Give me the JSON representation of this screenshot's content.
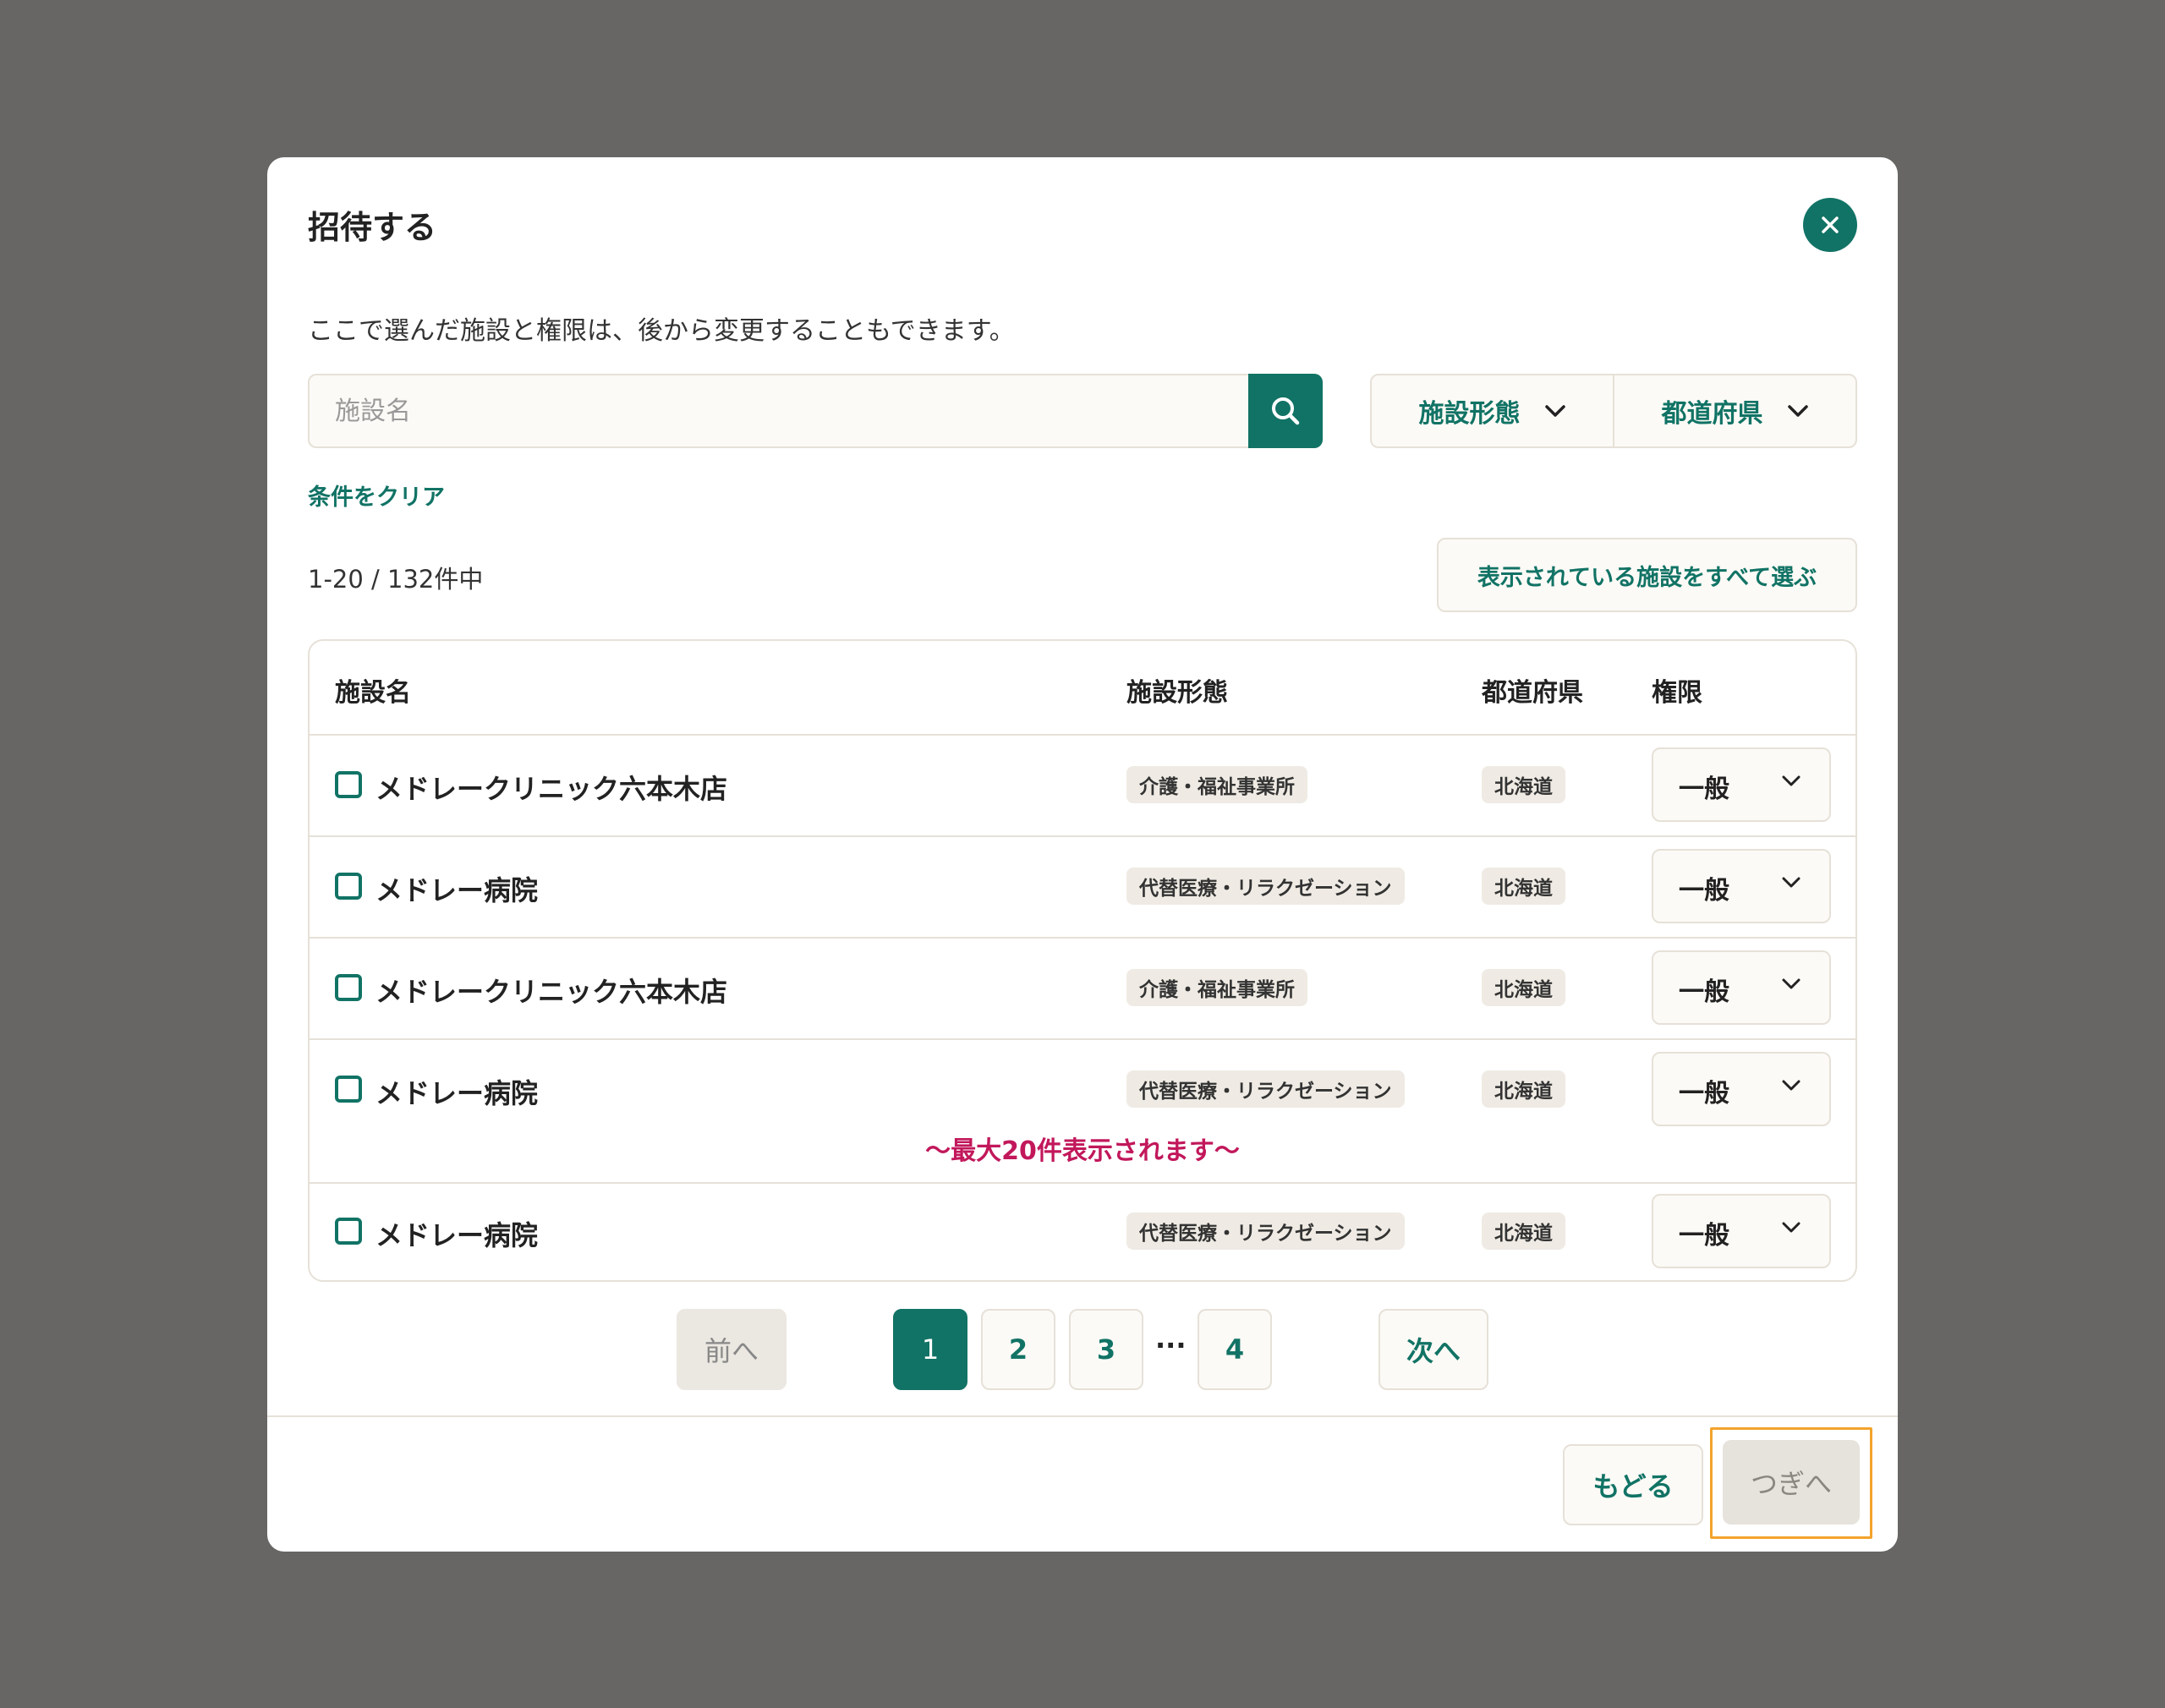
{
  "dialog": {
    "title": "招待する",
    "description": "ここで選んだ施設と権限は、後から変更することもできます。",
    "close_icon": "close-icon"
  },
  "search": {
    "placeholder": "施設名",
    "button_icon": "search-icon"
  },
  "filters": [
    {
      "label": "施設形態",
      "icon": "chevron-down-icon"
    },
    {
      "label": "都道府県",
      "icon": "chevron-down-icon"
    }
  ],
  "clear_label": "条件をクリア",
  "result_count": "1-20 / 132件中",
  "select_all_label": "表示されている施設をすべて選ぶ",
  "table": {
    "headers": [
      "施設名",
      "施設形態",
      "都道府県",
      "権限"
    ],
    "rows": [
      {
        "name": "メドレークリニック六本木店",
        "type": "介護・福祉事業所",
        "prefecture": "北海道",
        "permission": "一般",
        "checked": false
      },
      {
        "name": "メドレー病院",
        "type": "代替医療・リラクゼーション",
        "prefecture": "北海道",
        "permission": "一般",
        "checked": false
      },
      {
        "name": "メドレークリニック六本木店",
        "type": "介護・福祉事業所",
        "prefecture": "北海道",
        "permission": "一般",
        "checked": false
      },
      {
        "name": "メドレー病院",
        "type": "代替医療・リラクゼーション",
        "prefecture": "北海道",
        "permission": "一般",
        "checked": false
      },
      {
        "name": "メドレー病院",
        "type": "代替医療・リラクゼーション",
        "prefecture": "北海道",
        "permission": "一般",
        "checked": false
      }
    ],
    "max_note": "〜最大20件表示されます〜"
  },
  "pagination": {
    "prev_label": "前へ",
    "pages": [
      "1",
      "2",
      "3",
      "4"
    ],
    "current_page": "1",
    "ellipsis": "···",
    "next_label": "次へ"
  },
  "footer": {
    "back_label": "もどる",
    "next_label": "つぎへ"
  },
  "colors": {
    "backdrop": "#676664",
    "accent": "#117365",
    "note": "#c2185b",
    "highlight_outline": "#f3a32c",
    "disabled_bg": "#e6e2dc"
  }
}
